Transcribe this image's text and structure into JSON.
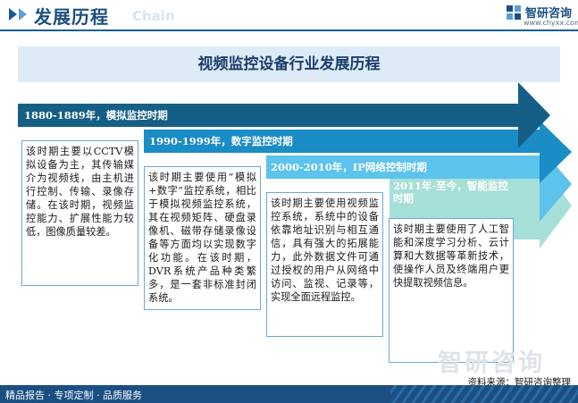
{
  "header": {
    "title": "发展历程",
    "watermark": "Chain",
    "logo_name": "智研咨询",
    "logo_url": "www.chyxx.com",
    "colors": {
      "primary": "#1b4f84",
      "accent": "#5aa1d2"
    }
  },
  "main_title": "视频监控设备行业发展历程",
  "stages": [
    {
      "title": "1880-1889年，模拟监控时期",
      "color": "#155f86",
      "description": "该时期主要以CCTV模拟设备为主，其传输媒介为视频线，由主机进行控制、传输、录像存储。在该时期，视频监控能力、扩展性能力较低，图像质量较差。"
    },
    {
      "title": "1990-1999年，数字监控时期",
      "color": "#1a8cc6",
      "description": "该时期主要使用“模拟+数字”监控系统，相比于模拟视频监控系统，其在视频矩阵、硬盘录像机、磁带存储录像设备等方面均以实现数字化功能。在该时期，DVR系统产品种类繁多，是一套非标准封闭系统。"
    },
    {
      "title": "2000-2010年，IP网络控制时期",
      "color": "#5cc3ec",
      "description": "该时期主要使用视频监控系统，系统中的设备依靠地址识别与相互通信，具有强大的拓展能力，此外数据文件可通过授权的用户从网络中访问、监视、记录等，实现全面远程监控。"
    },
    {
      "title": "2011年-至今，智能监控时期",
      "color": "#a6dfd8",
      "description": "该时期主要使用了人工智能和深度学习分析、云计算和大数据等革新技术，使操作人员及终端用户更快提取视频信息。"
    }
  ],
  "watermark_bottom": "智研咨询",
  "source": "资料来源：智研咨询整理",
  "footer": "精品报告 · 专项定制 · 品质服务"
}
